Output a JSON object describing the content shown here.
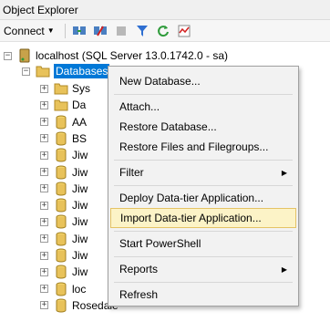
{
  "window": {
    "title": "Object Explorer"
  },
  "toolbar": {
    "connect_label": "Connect"
  },
  "tree": {
    "server": {
      "label": "localhost (SQL Server 13.0.1742.0 - sa)",
      "expander": "−"
    },
    "databases": {
      "label": "Databases",
      "expander": "−"
    },
    "children": [
      {
        "label": "Sys",
        "expander": "+"
      },
      {
        "label": "Da",
        "expander": "+"
      },
      {
        "label": "AA",
        "expander": "+"
      },
      {
        "label": "BS",
        "expander": "+"
      },
      {
        "label": "Jiw",
        "expander": "+"
      },
      {
        "label": "Jiw",
        "expander": "+"
      },
      {
        "label": "Jiw",
        "expander": "+"
      },
      {
        "label": "Jiw",
        "expander": "+"
      },
      {
        "label": "Jiw",
        "expander": "+"
      },
      {
        "label": "Jiw",
        "expander": "+"
      },
      {
        "label": "Jiw",
        "expander": "+"
      },
      {
        "label": "Jiw",
        "expander": "+"
      },
      {
        "label": "loc",
        "expander": "+"
      },
      {
        "label": "Rosedale",
        "expander": "+"
      }
    ]
  },
  "context_menu": {
    "new_database": "New Database...",
    "attach": "Attach...",
    "restore_database": "Restore Database...",
    "restore_files": "Restore Files and Filegroups...",
    "filter": "Filter",
    "deploy": "Deploy Data-tier Application...",
    "import": "Import Data-tier Application...",
    "powershell": "Start PowerShell",
    "reports": "Reports",
    "refresh": "Refresh",
    "submenu_arrow": "▶"
  },
  "colors": {
    "selection": "#0078d7",
    "highlight": "#fcf3c7",
    "highlight_border": "#e5c365"
  }
}
